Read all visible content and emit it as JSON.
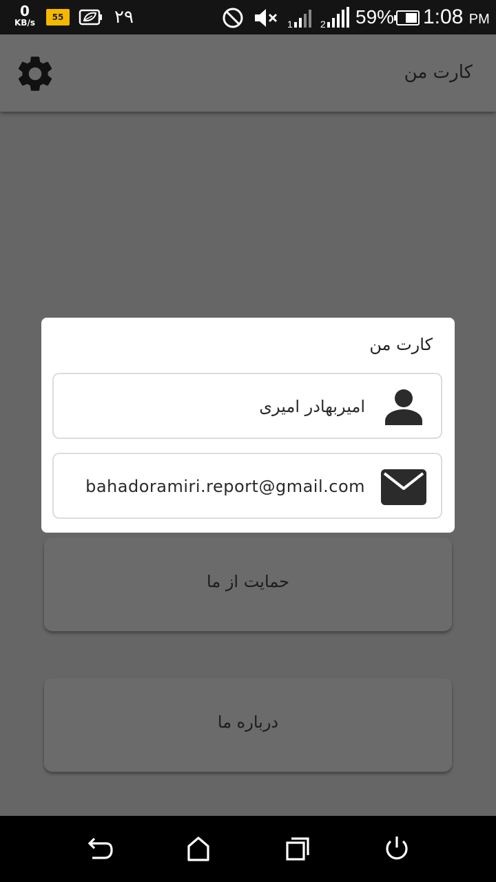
{
  "status_bar": {
    "net_speed": "0",
    "net_speed_unit": "KB/s",
    "badge": "55",
    "date": "۲۹",
    "battery_percent": "59%",
    "time": "1:08",
    "time_suffix": "PM",
    "icons": [
      "speed-icon",
      "notification-badge-icon",
      "leaf-battery-saver-icon",
      "do-not-disturb-icon",
      "mute-icon",
      "signal-sim1-icon",
      "signal-sim2-icon",
      "battery-icon"
    ]
  },
  "app_bar": {
    "title": "کارت من",
    "settings_icon": "gear-icon"
  },
  "menu": {
    "items": [
      {
        "label": "حمایت از ما"
      },
      {
        "label": "درباره ما"
      }
    ]
  },
  "dialog": {
    "title": "کارت من",
    "rows": [
      {
        "icon": "person-icon",
        "value": "امیربهادر امیری"
      },
      {
        "icon": "mail-icon",
        "value": "bahadoramiri.report@gmail.com"
      }
    ]
  },
  "nav_bar": {
    "buttons": [
      "back-icon",
      "home-icon",
      "recents-icon",
      "power-icon"
    ]
  },
  "colors": {
    "status_bar": "#141414",
    "scrim_background": "#666666",
    "dialog_background": "#ffffff",
    "badge": "#f5b800",
    "nav_bar": "#000000"
  }
}
